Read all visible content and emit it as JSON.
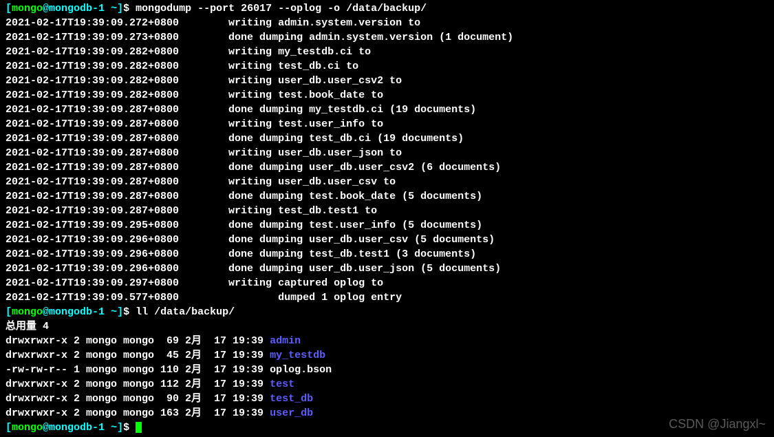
{
  "prompt1": {
    "bracket_open": "[",
    "user": "mongo",
    "at": "@",
    "host": "mongodb-1 ",
    "path": "~",
    "bracket_close": "]",
    "dollar": "$ ",
    "cmd": "mongodump --port 26017 --oplog -o /data/backup/"
  },
  "dump_lines": [
    {
      "ts": "2021-02-17T19:39:09.272+0800",
      "msg": "        writing admin.system.version to"
    },
    {
      "ts": "2021-02-17T19:39:09.273+0800",
      "msg": "        done dumping admin.system.version (1 document)"
    },
    {
      "ts": "2021-02-17T19:39:09.282+0800",
      "msg": "        writing my_testdb.ci to"
    },
    {
      "ts": "2021-02-17T19:39:09.282+0800",
      "msg": "        writing test_db.ci to"
    },
    {
      "ts": "2021-02-17T19:39:09.282+0800",
      "msg": "        writing user_db.user_csv2 to"
    },
    {
      "ts": "2021-02-17T19:39:09.282+0800",
      "msg": "        writing test.book_date to"
    },
    {
      "ts": "2021-02-17T19:39:09.287+0800",
      "msg": "        done dumping my_testdb.ci (19 documents)"
    },
    {
      "ts": "2021-02-17T19:39:09.287+0800",
      "msg": "        writing test.user_info to"
    },
    {
      "ts": "2021-02-17T19:39:09.287+0800",
      "msg": "        done dumping test_db.ci (19 documents)"
    },
    {
      "ts": "2021-02-17T19:39:09.287+0800",
      "msg": "        writing user_db.user_json to"
    },
    {
      "ts": "2021-02-17T19:39:09.287+0800",
      "msg": "        done dumping user_db.user_csv2 (6 documents)"
    },
    {
      "ts": "2021-02-17T19:39:09.287+0800",
      "msg": "        writing user_db.user_csv to"
    },
    {
      "ts": "2021-02-17T19:39:09.287+0800",
      "msg": "        done dumping test.book_date (5 documents)"
    },
    {
      "ts": "2021-02-17T19:39:09.287+0800",
      "msg": "        writing test_db.test1 to"
    },
    {
      "ts": "2021-02-17T19:39:09.295+0800",
      "msg": "        done dumping test.user_info (5 documents)"
    },
    {
      "ts": "2021-02-17T19:39:09.296+0800",
      "msg": "        done dumping user_db.user_csv (5 documents)"
    },
    {
      "ts": "2021-02-17T19:39:09.296+0800",
      "msg": "        done dumping test_db.test1 (3 documents)"
    },
    {
      "ts": "2021-02-17T19:39:09.296+0800",
      "msg": "        done dumping user_db.user_json (5 documents)"
    },
    {
      "ts": "2021-02-17T19:39:09.297+0800",
      "msg": "        writing captured oplog to"
    },
    {
      "ts": "2021-02-17T19:39:09.577+0800",
      "msg": "                dumped 1 oplog entry"
    }
  ],
  "prompt2": {
    "bracket_open": "[",
    "user": "mongo",
    "at": "@",
    "host": "mongodb-1 ",
    "path": "~",
    "bracket_close": "]",
    "dollar": "$ ",
    "cmd": "ll /data/backup/"
  },
  "total_line": "总用量 4",
  "ls_lines": [
    {
      "attrs": "drwxrwxr-x 2 mongo mongo  69 2月  17 19:39 ",
      "name": "admin",
      "is_dir": true
    },
    {
      "attrs": "drwxrwxr-x 2 mongo mongo  45 2月  17 19:39 ",
      "name": "my_testdb",
      "is_dir": true
    },
    {
      "attrs": "-rw-rw-r-- 1 mongo mongo 110 2月  17 19:39 ",
      "name": "oplog.bson",
      "is_dir": false
    },
    {
      "attrs": "drwxrwxr-x 2 mongo mongo 112 2月  17 19:39 ",
      "name": "test",
      "is_dir": true
    },
    {
      "attrs": "drwxrwxr-x 2 mongo mongo  90 2月  17 19:39 ",
      "name": "test_db",
      "is_dir": true
    },
    {
      "attrs": "drwxrwxr-x 2 mongo mongo 163 2月  17 19:39 ",
      "name": "user_db",
      "is_dir": true
    }
  ],
  "prompt3": {
    "bracket_open": "[",
    "user": "mongo",
    "at": "@",
    "host": "mongodb-1 ",
    "path": "~",
    "bracket_close": "]",
    "dollar": "$ "
  },
  "watermark": "CSDN @Jiangxl~"
}
